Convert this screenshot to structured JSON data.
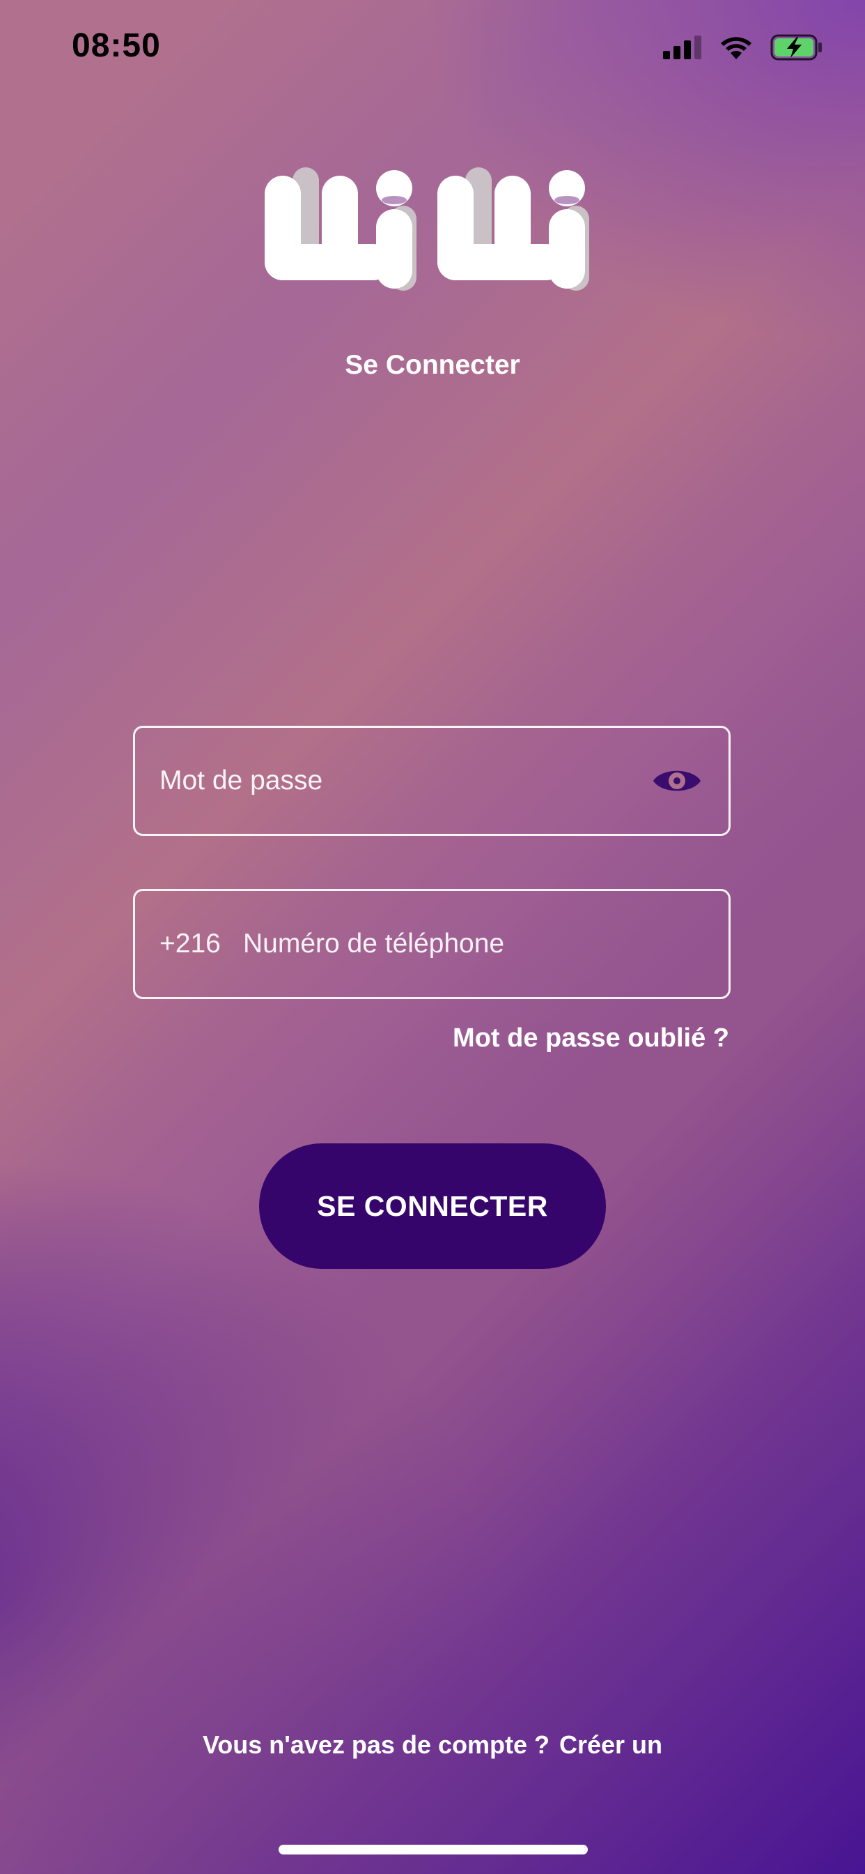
{
  "status_bar": {
    "time": "08:50",
    "icons": [
      "signal-icon",
      "wifi-icon",
      "battery-charging-icon"
    ]
  },
  "logo": {
    "text": "wiwi"
  },
  "header": {
    "title": "Se Connecter"
  },
  "form": {
    "password": {
      "placeholder": "Mot de passe",
      "toggle_icon": "eye-icon"
    },
    "phone": {
      "prefix": "+216",
      "placeholder": "Numéro de téléphone"
    },
    "forgot_label": "Mot de passe oublié ?",
    "submit_label": "SE CONNECTER"
  },
  "footer": {
    "prompt": "Vous n'avez pas de compte ?",
    "signup_label": "Créer un"
  },
  "colors": {
    "button": "#35056b",
    "eye_icon": "#3a0c6e",
    "accent_dark": "#481492",
    "accent_pink": "#b0708e"
  }
}
